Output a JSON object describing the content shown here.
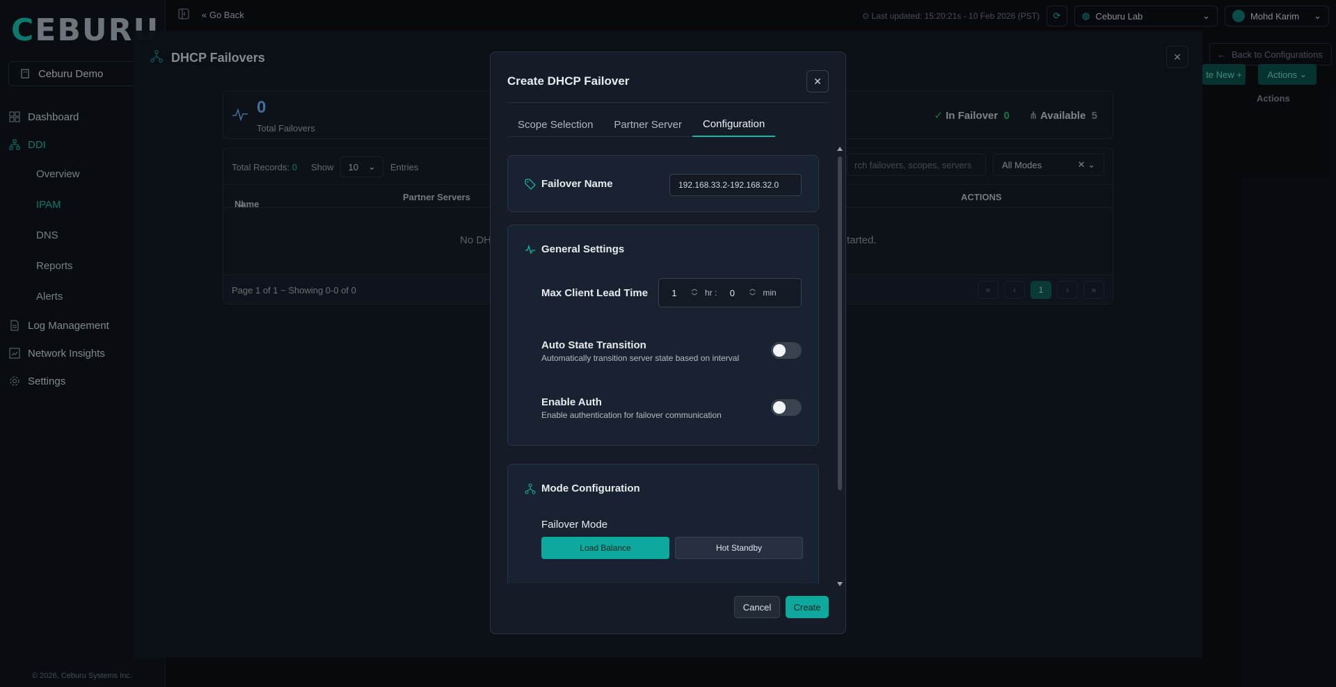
{
  "app": {
    "logo": "CEBURU",
    "org": "Ceburu Demo",
    "footer": "© 2026, Ceburu Systems Inc."
  },
  "sidebar": {
    "items": [
      {
        "label": "Dashboard",
        "icon": "grid-icon"
      },
      {
        "label": "DDI",
        "icon": "network-icon",
        "active": true
      },
      {
        "label": "Overview",
        "sub": true
      },
      {
        "label": "IPAM",
        "sub": true,
        "active": true
      },
      {
        "label": "DNS",
        "sub": true
      },
      {
        "label": "Reports",
        "sub": true
      },
      {
        "label": "Alerts",
        "sub": true
      },
      {
        "label": "Log Management",
        "icon": "document-icon"
      },
      {
        "label": "Network Insights",
        "icon": "chart-icon"
      },
      {
        "label": "Settings",
        "icon": "gear-icon"
      }
    ]
  },
  "topbar": {
    "go_back": "Go Back",
    "updated": "Last updated: 15:20:21s - 10 Feb 2026 (PST)",
    "site": "Ceburu Lab",
    "user": "Mohd Karim"
  },
  "background_right": {
    "back_to": "Back to Configurations",
    "create_new": "te New",
    "actions_btn": "Actions",
    "actions_col": "Actions"
  },
  "panel": {
    "title": "DHCP Failovers",
    "total": "0",
    "total_label": "Total Failovers",
    "in_failover_label": "In Failover",
    "in_failover": "0",
    "available_label": "Available",
    "available": "5",
    "total_records_label": "Total Records:",
    "total_records": "0",
    "show_label": "Show",
    "show_value": "10",
    "entries_label": "Entries",
    "search_placeholder": "rch failovers, scopes, servers",
    "mode_filter": "All Modes",
    "col_name": "Name",
    "col_partner": "Partner Servers",
    "col_actions": "ACTIONS",
    "empty_left": "No DH",
    "empty_right": "tarted.",
    "page_info": "Page 1 of 1 ~ Showing 0-0 of 0",
    "current_page": "1"
  },
  "modal": {
    "title": "Create DHCP Failover",
    "tabs": [
      "Scope Selection",
      "Partner Server",
      "Configuration"
    ],
    "active_tab": 2,
    "failover_name_label": "Failover Name",
    "failover_name_value": "192.168.33.2-192.168.32.0",
    "general_title": "General Settings",
    "lead_time_label": "Max Client Lead Time",
    "lead_hr": "1",
    "hr_unit": "hr :",
    "lead_min": "0",
    "min_unit": "min",
    "auto_state_label": "Auto State Transition",
    "auto_state_desc": "Automatically transition server state based on interval",
    "auto_state_on": false,
    "enable_auth_label": "Enable Auth",
    "enable_auth_desc": "Enable authentication for failover communication",
    "enable_auth_on": false,
    "mode_title": "Mode Configuration",
    "failover_mode_label": "Failover Mode",
    "mode_load_balance": "Load Balance",
    "mode_hot_standby": "Hot Standby",
    "cancel": "Cancel",
    "create": "Create"
  },
  "colors": {
    "accent": "#14b8a6",
    "background": "#0b0f15",
    "modal_bg": "#151c27"
  }
}
